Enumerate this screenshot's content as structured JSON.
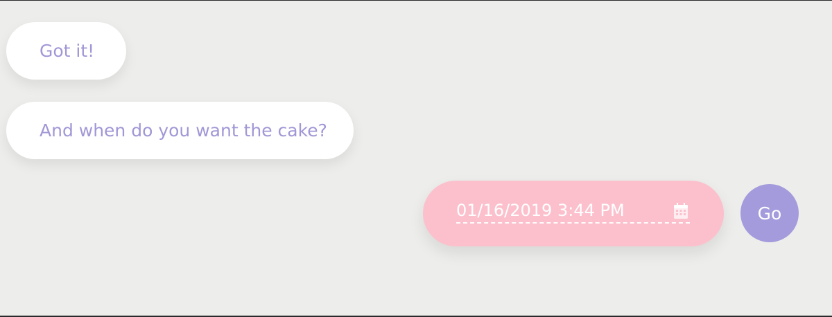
{
  "messages": [
    {
      "text": "Got it!"
    },
    {
      "text": "And when do you want the cake?"
    }
  ],
  "datetime_input": {
    "value": "01/16/2019 3:44 PM",
    "icon": "calendar-icon"
  },
  "go_button": {
    "label": "Go"
  },
  "colors": {
    "background": "#ededeb",
    "bot_bubble": "#ffffff",
    "bot_text": "#a097d6",
    "user_bubble": "#fcc0cc",
    "go_button": "#a39bdc"
  }
}
